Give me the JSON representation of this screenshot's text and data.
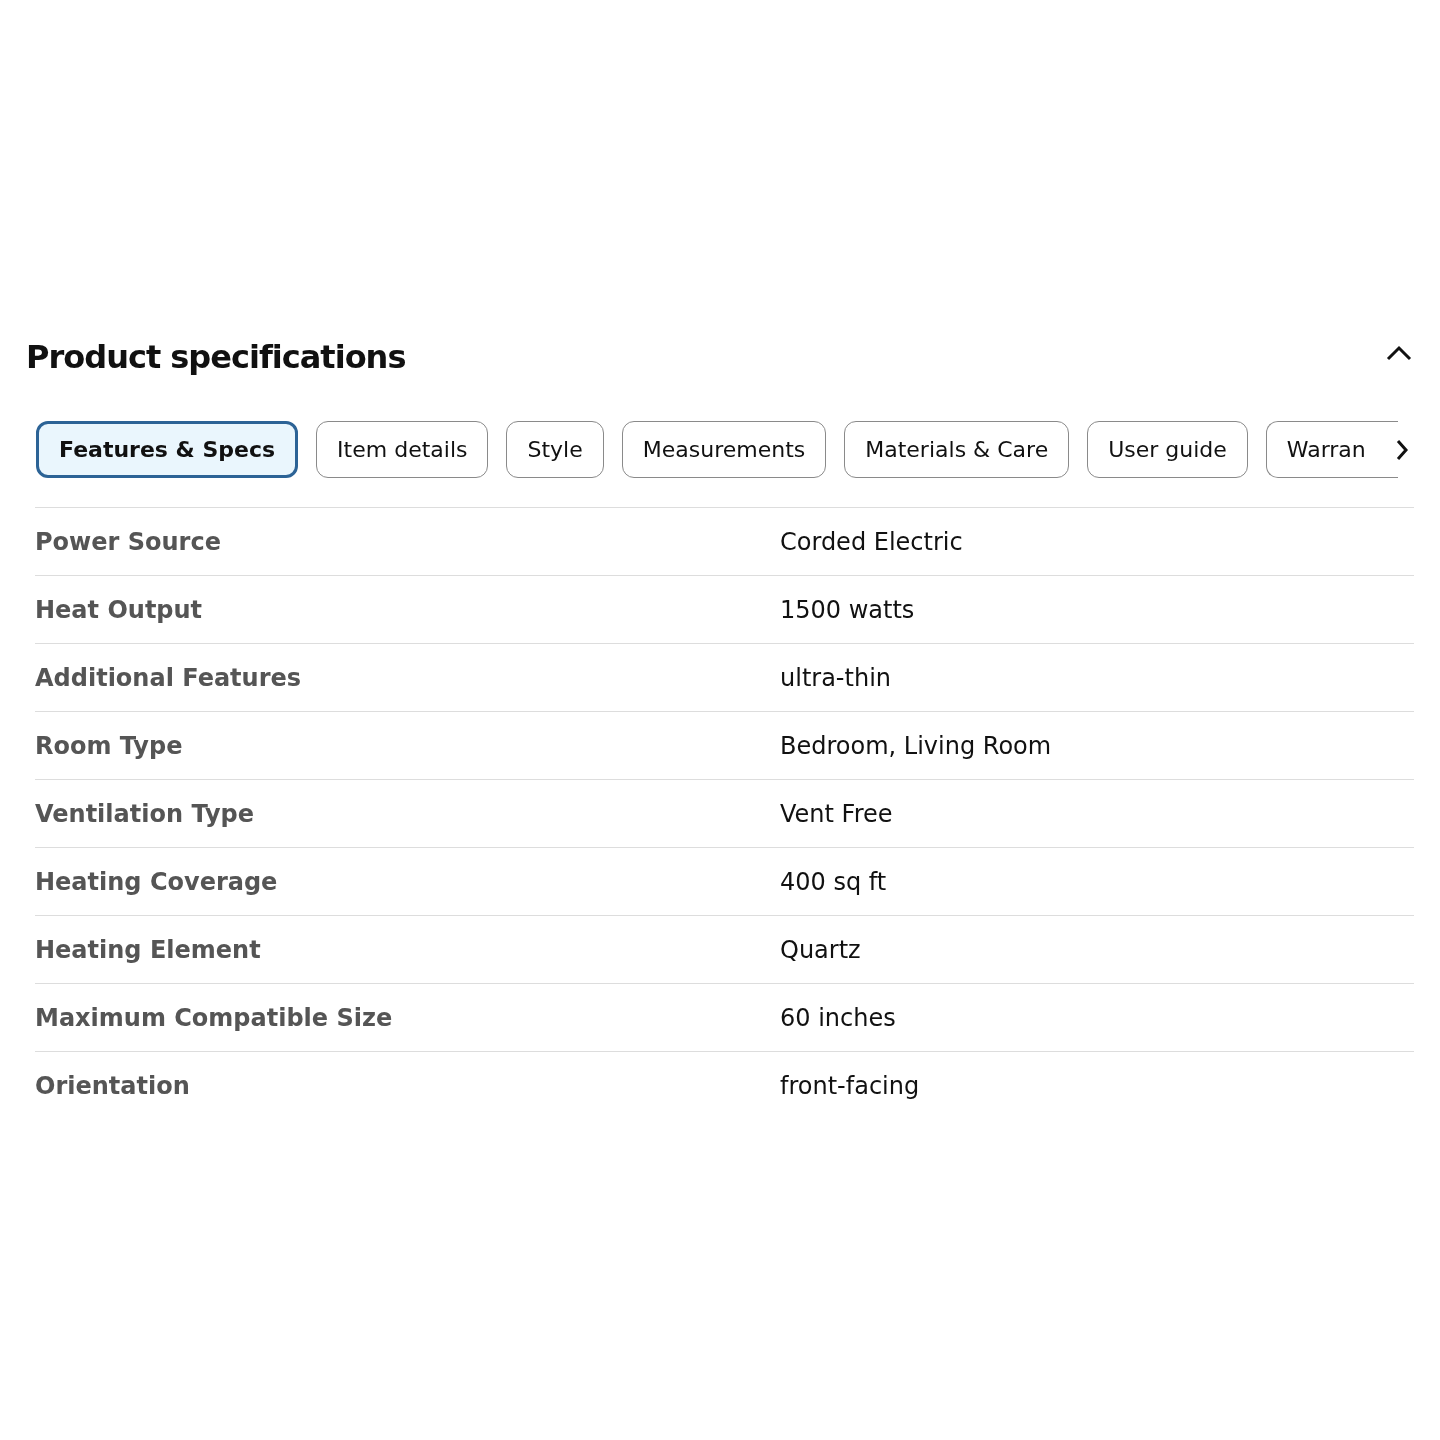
{
  "section": {
    "title": "Product specifications",
    "expanded": true
  },
  "tabs": [
    {
      "label": "Features & Specs",
      "selected": true
    },
    {
      "label": "Item details",
      "selected": false
    },
    {
      "label": "Style",
      "selected": false
    },
    {
      "label": "Measurements",
      "selected": false
    },
    {
      "label": "Materials & Care",
      "selected": false
    },
    {
      "label": "User guide",
      "selected": false
    },
    {
      "label": "Warran",
      "selected": false,
      "cut": true
    }
  ],
  "specs": [
    {
      "name": "Power Source",
      "value": "Corded Electric"
    },
    {
      "name": "Heat Output",
      "value": "1500 watts"
    },
    {
      "name": "Additional Features",
      "value": "ultra-thin"
    },
    {
      "name": "Room Type",
      "value": "Bedroom, Living Room"
    },
    {
      "name": "Ventilation Type",
      "value": "Vent Free"
    },
    {
      "name": "Heating Coverage",
      "value": "400 sq ft"
    },
    {
      "name": "Heating Element",
      "value": "Quartz"
    },
    {
      "name": "Maximum Compatible Size",
      "value": "60 inches"
    },
    {
      "name": "Orientation",
      "value": "front-facing"
    }
  ]
}
